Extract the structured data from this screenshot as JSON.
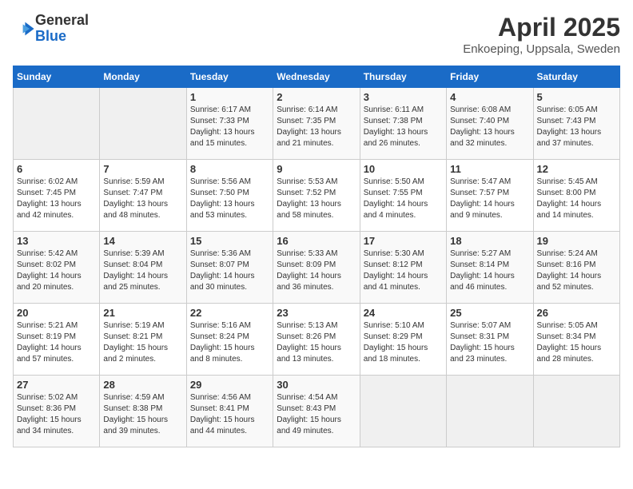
{
  "header": {
    "logo_general": "General",
    "logo_blue": "Blue",
    "title": "April 2025",
    "subtitle": "Enkoeping, Uppsala, Sweden"
  },
  "days_of_week": [
    "Sunday",
    "Monday",
    "Tuesday",
    "Wednesday",
    "Thursday",
    "Friday",
    "Saturday"
  ],
  "weeks": [
    [
      {
        "day": "",
        "info": ""
      },
      {
        "day": "",
        "info": ""
      },
      {
        "day": "1",
        "info": "Sunrise: 6:17 AM\nSunset: 7:33 PM\nDaylight: 13 hours and 15 minutes."
      },
      {
        "day": "2",
        "info": "Sunrise: 6:14 AM\nSunset: 7:35 PM\nDaylight: 13 hours and 21 minutes."
      },
      {
        "day": "3",
        "info": "Sunrise: 6:11 AM\nSunset: 7:38 PM\nDaylight: 13 hours and 26 minutes."
      },
      {
        "day": "4",
        "info": "Sunrise: 6:08 AM\nSunset: 7:40 PM\nDaylight: 13 hours and 32 minutes."
      },
      {
        "day": "5",
        "info": "Sunrise: 6:05 AM\nSunset: 7:43 PM\nDaylight: 13 hours and 37 minutes."
      }
    ],
    [
      {
        "day": "6",
        "info": "Sunrise: 6:02 AM\nSunset: 7:45 PM\nDaylight: 13 hours and 42 minutes."
      },
      {
        "day": "7",
        "info": "Sunrise: 5:59 AM\nSunset: 7:47 PM\nDaylight: 13 hours and 48 minutes."
      },
      {
        "day": "8",
        "info": "Sunrise: 5:56 AM\nSunset: 7:50 PM\nDaylight: 13 hours and 53 minutes."
      },
      {
        "day": "9",
        "info": "Sunrise: 5:53 AM\nSunset: 7:52 PM\nDaylight: 13 hours and 58 minutes."
      },
      {
        "day": "10",
        "info": "Sunrise: 5:50 AM\nSunset: 7:55 PM\nDaylight: 14 hours and 4 minutes."
      },
      {
        "day": "11",
        "info": "Sunrise: 5:47 AM\nSunset: 7:57 PM\nDaylight: 14 hours and 9 minutes."
      },
      {
        "day": "12",
        "info": "Sunrise: 5:45 AM\nSunset: 8:00 PM\nDaylight: 14 hours and 14 minutes."
      }
    ],
    [
      {
        "day": "13",
        "info": "Sunrise: 5:42 AM\nSunset: 8:02 PM\nDaylight: 14 hours and 20 minutes."
      },
      {
        "day": "14",
        "info": "Sunrise: 5:39 AM\nSunset: 8:04 PM\nDaylight: 14 hours and 25 minutes."
      },
      {
        "day": "15",
        "info": "Sunrise: 5:36 AM\nSunset: 8:07 PM\nDaylight: 14 hours and 30 minutes."
      },
      {
        "day": "16",
        "info": "Sunrise: 5:33 AM\nSunset: 8:09 PM\nDaylight: 14 hours and 36 minutes."
      },
      {
        "day": "17",
        "info": "Sunrise: 5:30 AM\nSunset: 8:12 PM\nDaylight: 14 hours and 41 minutes."
      },
      {
        "day": "18",
        "info": "Sunrise: 5:27 AM\nSunset: 8:14 PM\nDaylight: 14 hours and 46 minutes."
      },
      {
        "day": "19",
        "info": "Sunrise: 5:24 AM\nSunset: 8:16 PM\nDaylight: 14 hours and 52 minutes."
      }
    ],
    [
      {
        "day": "20",
        "info": "Sunrise: 5:21 AM\nSunset: 8:19 PM\nDaylight: 14 hours and 57 minutes."
      },
      {
        "day": "21",
        "info": "Sunrise: 5:19 AM\nSunset: 8:21 PM\nDaylight: 15 hours and 2 minutes."
      },
      {
        "day": "22",
        "info": "Sunrise: 5:16 AM\nSunset: 8:24 PM\nDaylight: 15 hours and 8 minutes."
      },
      {
        "day": "23",
        "info": "Sunrise: 5:13 AM\nSunset: 8:26 PM\nDaylight: 15 hours and 13 minutes."
      },
      {
        "day": "24",
        "info": "Sunrise: 5:10 AM\nSunset: 8:29 PM\nDaylight: 15 hours and 18 minutes."
      },
      {
        "day": "25",
        "info": "Sunrise: 5:07 AM\nSunset: 8:31 PM\nDaylight: 15 hours and 23 minutes."
      },
      {
        "day": "26",
        "info": "Sunrise: 5:05 AM\nSunset: 8:34 PM\nDaylight: 15 hours and 28 minutes."
      }
    ],
    [
      {
        "day": "27",
        "info": "Sunrise: 5:02 AM\nSunset: 8:36 PM\nDaylight: 15 hours and 34 minutes."
      },
      {
        "day": "28",
        "info": "Sunrise: 4:59 AM\nSunset: 8:38 PM\nDaylight: 15 hours and 39 minutes."
      },
      {
        "day": "29",
        "info": "Sunrise: 4:56 AM\nSunset: 8:41 PM\nDaylight: 15 hours and 44 minutes."
      },
      {
        "day": "30",
        "info": "Sunrise: 4:54 AM\nSunset: 8:43 PM\nDaylight: 15 hours and 49 minutes."
      },
      {
        "day": "",
        "info": ""
      },
      {
        "day": "",
        "info": ""
      },
      {
        "day": "",
        "info": ""
      }
    ]
  ]
}
